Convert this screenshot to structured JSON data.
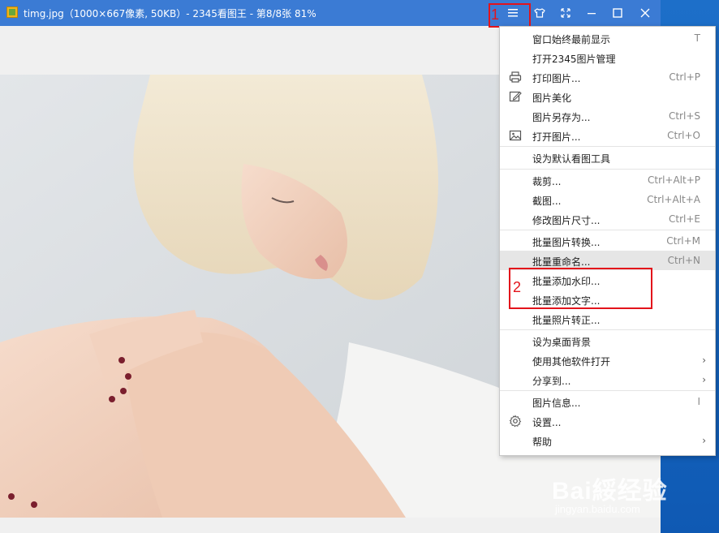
{
  "window": {
    "title": "timg.jpg（1000×667像素, 50KB）- 2345看图王 - 第8/8张 81%"
  },
  "titlebar_buttons": [
    "menu-icon",
    "skin-icon",
    "fullscreen-icon",
    "minimize-icon",
    "maximize-icon",
    "close-icon"
  ],
  "annotations": {
    "box1_label": "1",
    "box2_label": "2",
    "color": "#e3141b"
  },
  "menu": {
    "items": [
      {
        "label": "窗口始终最前显示",
        "shortcut": "T"
      },
      {
        "label": "打开2345图片管理",
        "shortcut": ""
      },
      {
        "label": "打印图片...",
        "shortcut": "Ctrl+P",
        "icon": "printer-icon"
      },
      {
        "label": "图片美化",
        "shortcut": "",
        "icon": "edit-icon"
      },
      {
        "label": "图片另存为...",
        "shortcut": "Ctrl+S"
      },
      {
        "label": "打开图片...",
        "shortcut": "Ctrl+O",
        "icon": "image-icon"
      },
      {
        "label": "设为默认看图工具",
        "shortcut": ""
      },
      {
        "label": "裁剪...",
        "shortcut": "Ctrl+Alt+P"
      },
      {
        "label": "截图...",
        "shortcut": "Ctrl+Alt+A"
      },
      {
        "label": "修改图片尺寸...",
        "shortcut": "Ctrl+E"
      },
      {
        "label": "批量图片转换...",
        "shortcut": "Ctrl+M"
      },
      {
        "label": "批量重命名...",
        "shortcut": "Ctrl+N"
      },
      {
        "label": "批量添加水印...",
        "shortcut": ""
      },
      {
        "label": "批量添加文字...",
        "shortcut": ""
      },
      {
        "label": "批量照片转正...",
        "shortcut": ""
      },
      {
        "label": "设为桌面背景",
        "shortcut": ""
      },
      {
        "label": "使用其他软件打开",
        "shortcut": "",
        "submenu": true
      },
      {
        "label": "分享到...",
        "shortcut": "",
        "submenu": true
      },
      {
        "label": "图片信息...",
        "shortcut": "I"
      },
      {
        "label": "设置...",
        "shortcut": "",
        "icon": "gear-icon"
      },
      {
        "label": "帮助",
        "shortcut": "",
        "submenu": true
      }
    ],
    "highlighted_item": "批量重命名...",
    "submenu_arrow": "›"
  },
  "watermark": {
    "main": "Bai綏经验",
    "sub": "jingyan.baidu.com"
  }
}
